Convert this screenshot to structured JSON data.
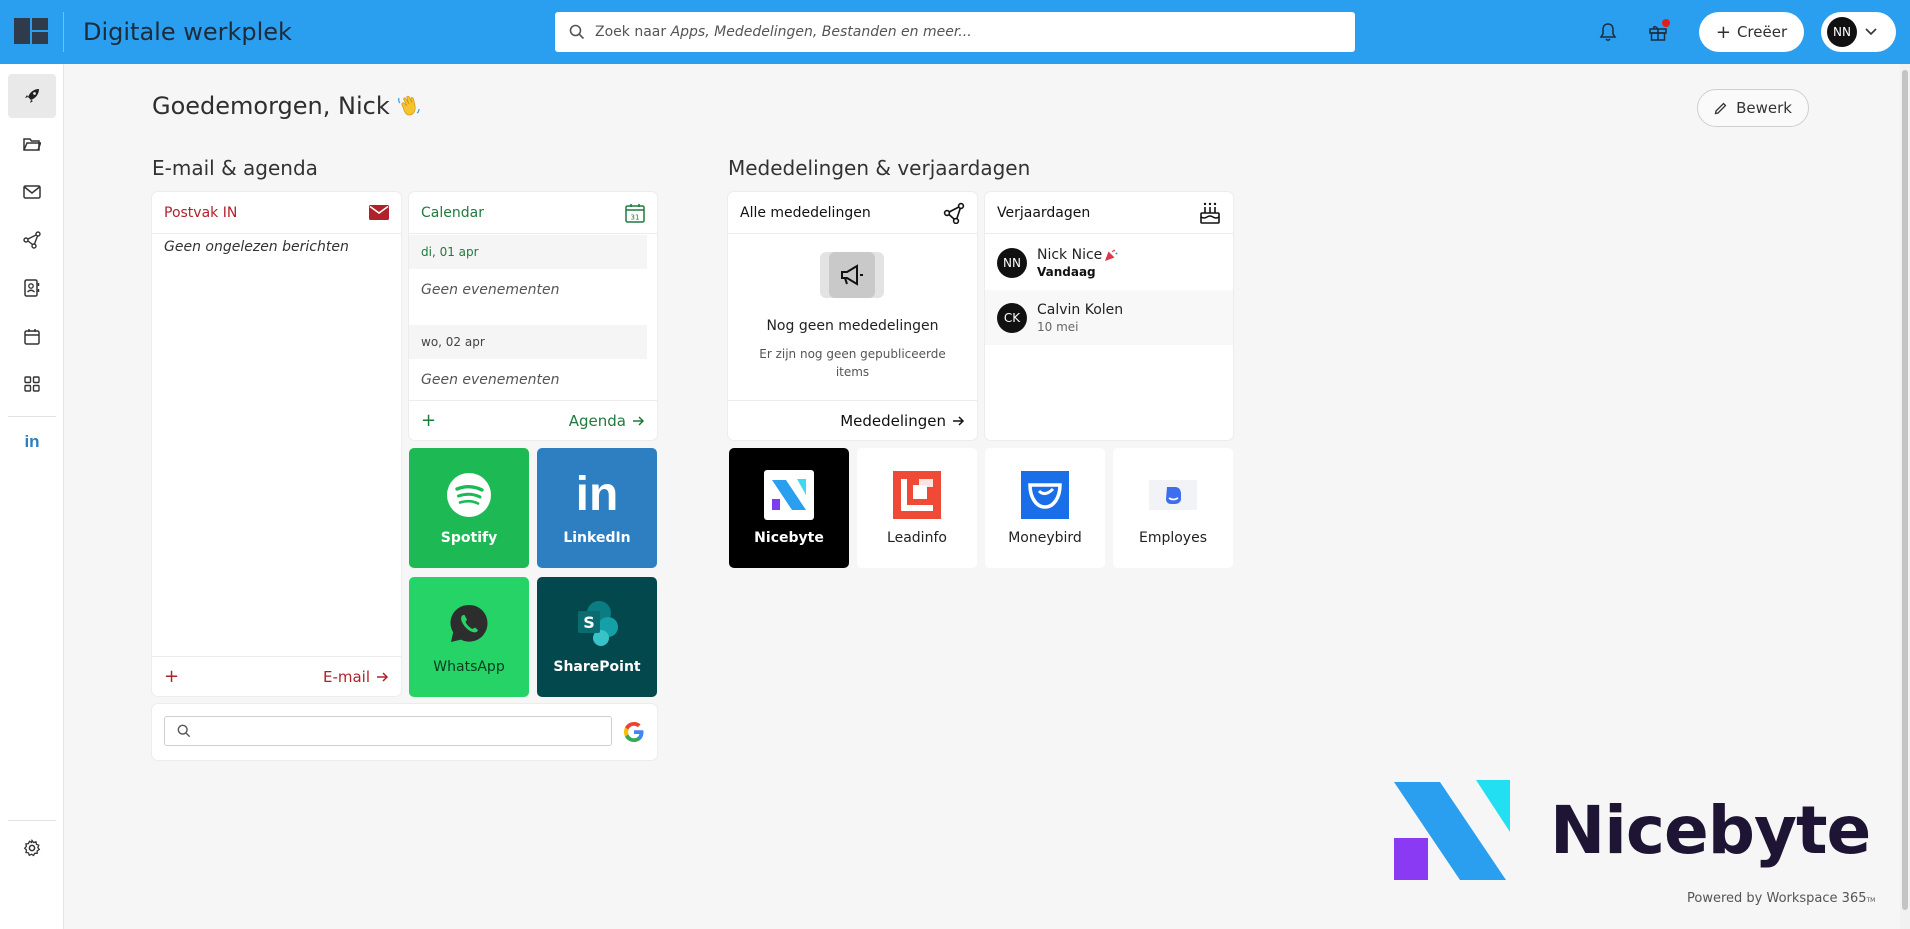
{
  "app": {
    "title": "Digitale werkplek"
  },
  "search": {
    "prefix": "Zoek naar ",
    "suffix": "Apps, Mededelingen, Bestanden en meer..."
  },
  "header": {
    "create_label": "Creëer",
    "user_initials": "NN"
  },
  "colors": {
    "topbar": "#2a9ff0",
    "mail_red": "#b0222a",
    "calendar_green": "#1f7a3d"
  },
  "sidebar": {
    "items": [
      {
        "name": "rocket-icon",
        "active": true
      },
      {
        "name": "folder-icon"
      },
      {
        "name": "mail-icon"
      },
      {
        "name": "share-icon"
      },
      {
        "name": "contacts-icon"
      },
      {
        "name": "calendar-icon"
      },
      {
        "name": "apps-grid-icon"
      },
      {
        "name": "linkedin-icon"
      },
      {
        "name": "gear-icon"
      }
    ]
  },
  "main": {
    "greeting": "Goedemorgen, Nick",
    "edit_label": "Bewerk",
    "email_section_title": "E-mail & agenda",
    "news_section_title": "Mededelingen & verjaardagen"
  },
  "inbox": {
    "title": "Postvak IN",
    "empty": "Geen ongelezen berichten",
    "add": "+",
    "link": "E-mail"
  },
  "calendar": {
    "title": "Calendar",
    "days": [
      {
        "label": "di, 01 apr",
        "empty": "Geen evenementen"
      },
      {
        "label": "wo, 02 apr",
        "empty": "Geen evenementen"
      }
    ],
    "add": "+",
    "link": "Agenda"
  },
  "announcements": {
    "title": "Alle mededelingen",
    "empty_title": "Nog geen mededelingen",
    "empty_text": "Er zijn nog geen gepubliceerde items",
    "link": "Mededelingen"
  },
  "birthdays": {
    "title": "Verjaardagen",
    "people": [
      {
        "initials": "NN",
        "name": "Nick Nice",
        "date": "Vandaag"
      },
      {
        "initials": "CK",
        "name": "Calvin Kolen",
        "date": "10 mei"
      }
    ]
  },
  "apps": [
    {
      "name": "Spotify",
      "color": "#1db954"
    },
    {
      "name": "LinkedIn",
      "color": "#2d7fc1"
    },
    {
      "name": "WhatsApp",
      "color": "#25d366"
    },
    {
      "name": "SharePoint",
      "color": "#03484c"
    },
    {
      "name": "Nicebyte",
      "color": "#000000"
    },
    {
      "name": "Leadinfo",
      "color": "#ffffff"
    },
    {
      "name": "Moneybird",
      "color": "#ffffff"
    },
    {
      "name": "Employes",
      "color": "#ffffff"
    }
  ],
  "brand": {
    "name": "Nicebyte",
    "powered_by": "Powered by Workspace 365",
    "powered_tm": "TM"
  }
}
